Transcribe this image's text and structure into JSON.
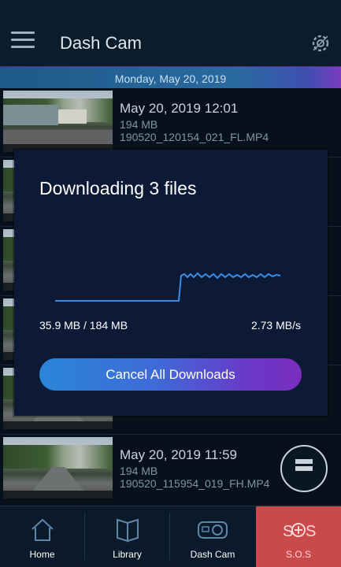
{
  "header": {
    "title": "Dash Cam"
  },
  "date_bar": {
    "label": "Monday, May 20, 2019"
  },
  "rows": [
    {
      "title": "May 20, 2019 12:01",
      "size": "194 MB",
      "file": "190520_120154_021_FL.MP4"
    },
    {
      "title": "May 20, 2019 11:59",
      "size": "194 MB",
      "file": "190520_115954_019_FH.MP4"
    }
  ],
  "dialog": {
    "title": "Downloading 3 files",
    "progress": "35.9 MB / 184 MB",
    "speed": "2.73 MB/s",
    "cancel_label": "Cancel All Downloads"
  },
  "nav": [
    {
      "label": "Home",
      "icon": "home-icon"
    },
    {
      "label": "Library",
      "icon": "book-icon"
    },
    {
      "label": "Dash Cam",
      "icon": "camera-icon"
    },
    {
      "label": "S.O.S",
      "icon": "sos-icon"
    }
  ],
  "colors": {
    "accent": "#3a8ee8",
    "sos": "#c94a4a",
    "background": "#06111c"
  }
}
